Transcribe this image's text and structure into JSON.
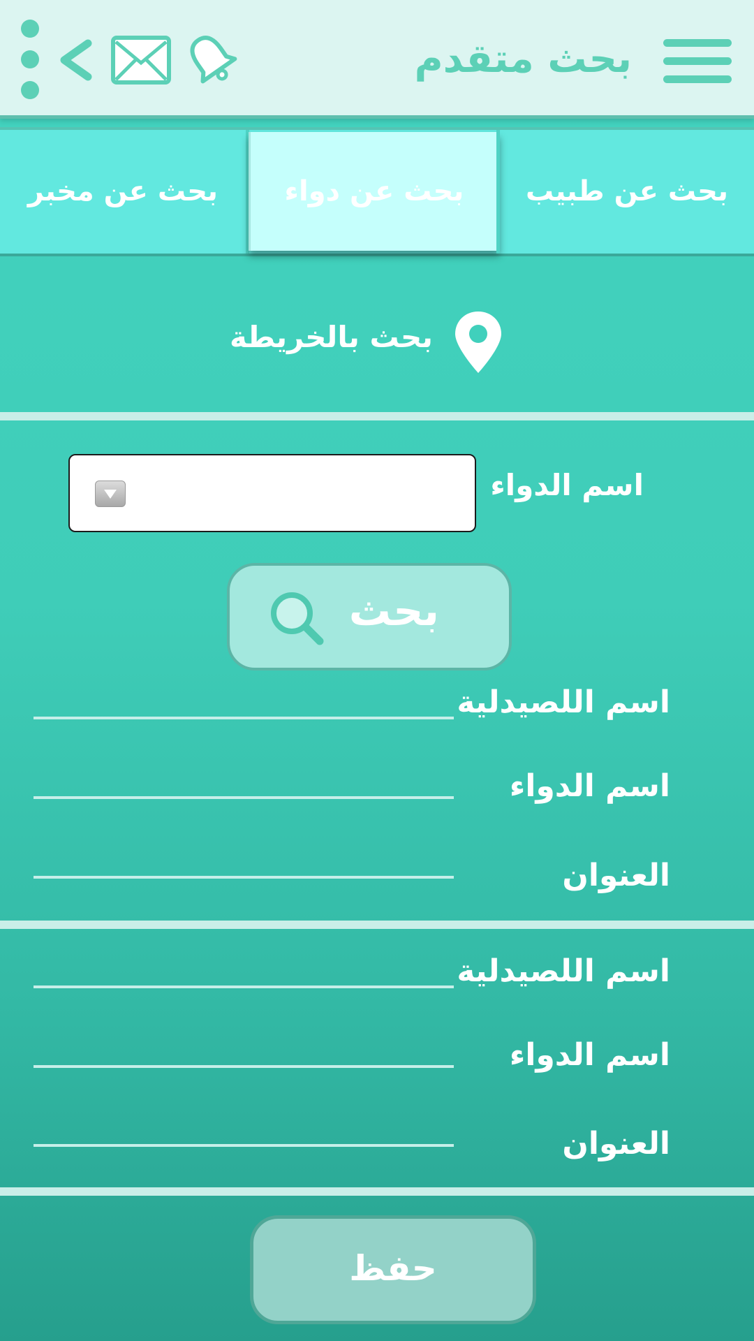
{
  "header": {
    "title": "بحث متقدم",
    "icons": [
      "menu-icon",
      "more-vert-icon",
      "back-chevron-icon",
      "mail-icon",
      "bell-icon"
    ]
  },
  "tabs": [
    {
      "label": "بحث عن طبيب",
      "active": false
    },
    {
      "label": "بحث عن دواء",
      "active": true
    },
    {
      "label": "بحث عن مخبر",
      "active": false
    }
  ],
  "map_search": {
    "label": "بحث بالخريطة",
    "icon": "map-pin-icon"
  },
  "drug_field": {
    "label": "اسم الدواء",
    "value": ""
  },
  "search_button": {
    "label": "بحث",
    "icon": "search-icon"
  },
  "results": [
    {
      "pharmacy_label": "اسم اللصيدلية",
      "drug_label": "اسم الدواء",
      "address_label": "العنوان"
    },
    {
      "pharmacy_label": "اسم اللصيدلية",
      "drug_label": "اسم الدواء",
      "address_label": "العنوان"
    }
  ],
  "save_button": {
    "label": "حفظ"
  },
  "colors": {
    "accent": "#5cd0b6",
    "header_bg": "#dcf5f1",
    "tab_bg": "#62e8df",
    "tab_active_bg": "#c5fffc",
    "body_top": "#43d3bf",
    "body_bottom": "#269f8d"
  }
}
